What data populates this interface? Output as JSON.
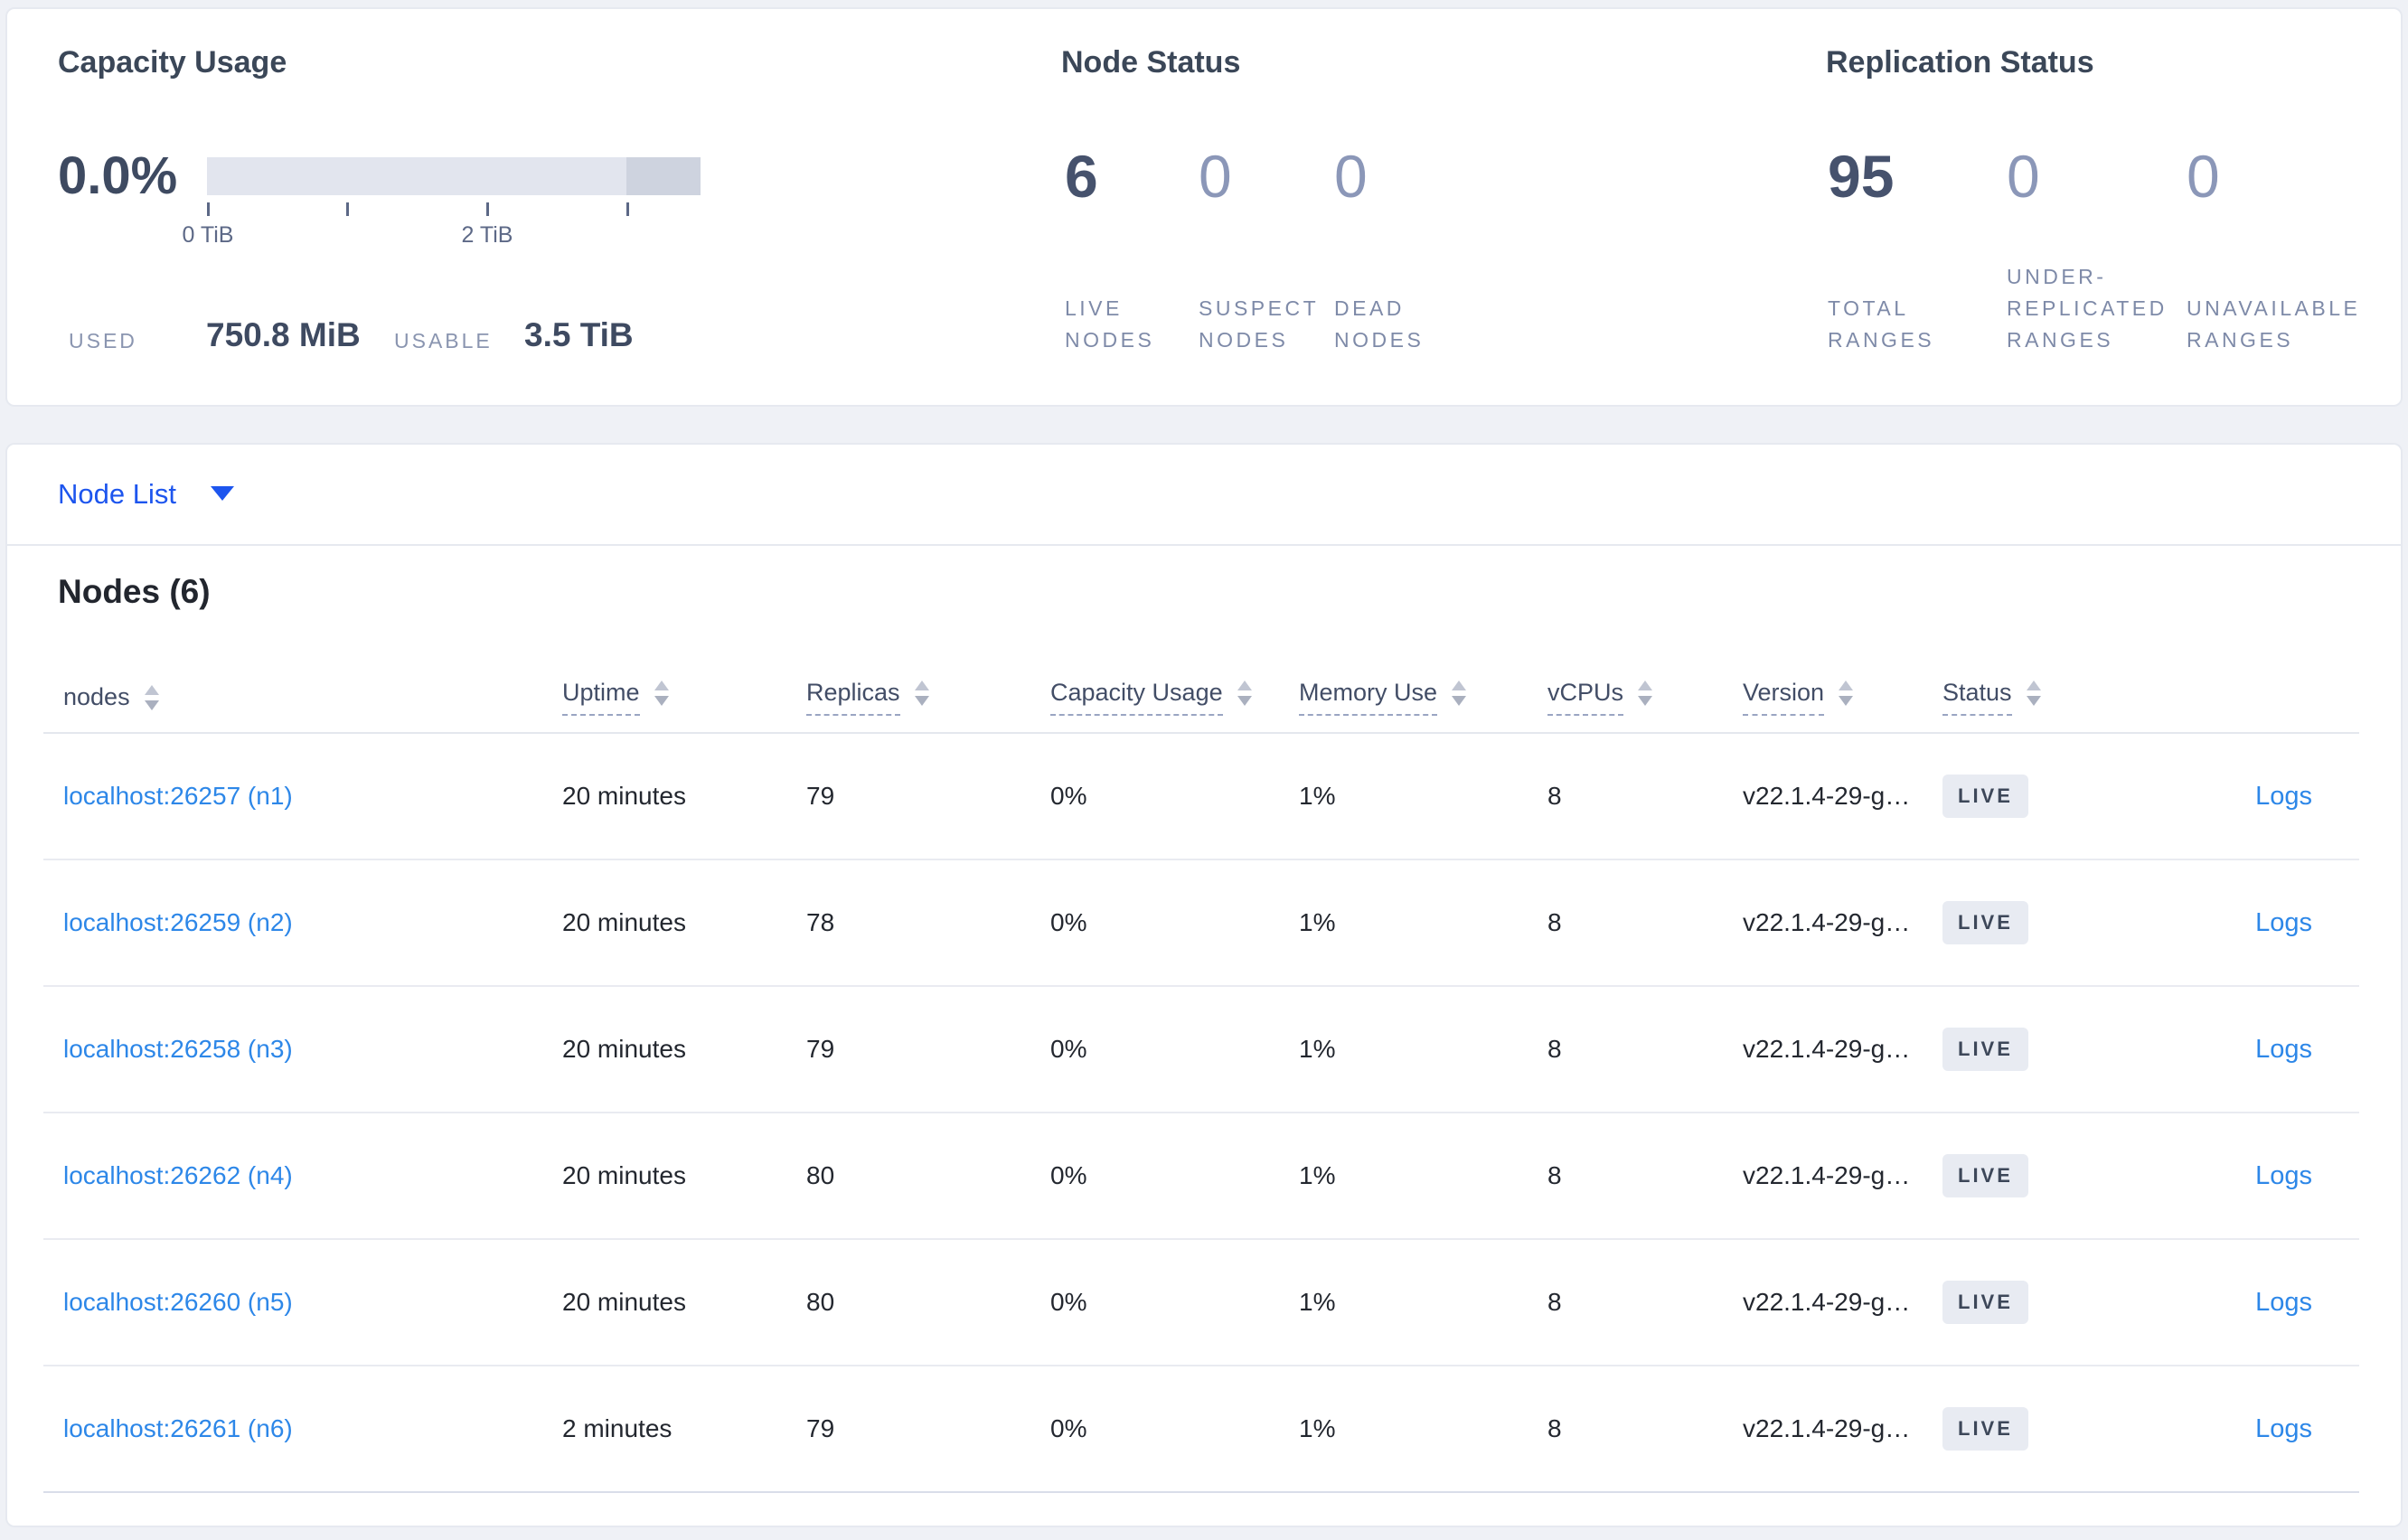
{
  "colors": {
    "page_bg": "#eff1f6",
    "card_bg": "#ffffff",
    "link_blue": "#2d87e8",
    "dropdown_blue": "#1d55ee",
    "badge_bg": "#e8ebf2",
    "gauge_light": "#e2e5ee",
    "gauge_dark": "#ced3df",
    "primary_number": "#46526d",
    "dim_number": "#8b97b8"
  },
  "capacity": {
    "title": "Capacity Usage",
    "percent": "0.0%",
    "gauge": {
      "tick_labels": [
        "0 TiB",
        "",
        "2 TiB",
        ""
      ],
      "dark_segment_start_frac": 0.85
    },
    "used_label": "USED",
    "used_value": "750.8 MiB",
    "usable_label": "USABLE",
    "usable_value": "3.5 TiB"
  },
  "node_status": {
    "title": "Node Status",
    "stats": [
      {
        "value": "6",
        "label": "LIVE NODES"
      },
      {
        "value": "0",
        "label": "SUSPECT NODES"
      },
      {
        "value": "0",
        "label": "DEAD NODES"
      }
    ]
  },
  "replication": {
    "title": "Replication Status",
    "stats": [
      {
        "value": "95",
        "label": "TOTAL RANGES"
      },
      {
        "value": "0",
        "label": "UNDER-REPLICATED RANGES"
      },
      {
        "value": "0",
        "label": "UNAVAILABLE RANGES"
      }
    ]
  },
  "node_list": {
    "dropdown_label": "Node List",
    "heading": "Nodes (6)",
    "columns": [
      "nodes",
      "Uptime",
      "Replicas",
      "Capacity Usage",
      "Memory Use",
      "vCPUs",
      "Version",
      "Status"
    ],
    "logs_label": "Logs",
    "rows": [
      {
        "node": "localhost:26257 (n1)",
        "uptime": "20 minutes",
        "replicas": "79",
        "capacity": "0%",
        "memory": "1%",
        "vcpus": "8",
        "version": "v22.1.4-29-g…",
        "status": "LIVE"
      },
      {
        "node": "localhost:26259 (n2)",
        "uptime": "20 minutes",
        "replicas": "78",
        "capacity": "0%",
        "memory": "1%",
        "vcpus": "8",
        "version": "v22.1.4-29-g…",
        "status": "LIVE"
      },
      {
        "node": "localhost:26258 (n3)",
        "uptime": "20 minutes",
        "replicas": "79",
        "capacity": "0%",
        "memory": "1%",
        "vcpus": "8",
        "version": "v22.1.4-29-g…",
        "status": "LIVE"
      },
      {
        "node": "localhost:26262 (n4)",
        "uptime": "20 minutes",
        "replicas": "80",
        "capacity": "0%",
        "memory": "1%",
        "vcpus": "8",
        "version": "v22.1.4-29-g…",
        "status": "LIVE"
      },
      {
        "node": "localhost:26260 (n5)",
        "uptime": "20 minutes",
        "replicas": "80",
        "capacity": "0%",
        "memory": "1%",
        "vcpus": "8",
        "version": "v22.1.4-29-g…",
        "status": "LIVE"
      },
      {
        "node": "localhost:26261 (n6)",
        "uptime": "2 minutes",
        "replicas": "79",
        "capacity": "0%",
        "memory": "1%",
        "vcpus": "8",
        "version": "v22.1.4-29-g…",
        "status": "LIVE"
      }
    ]
  }
}
